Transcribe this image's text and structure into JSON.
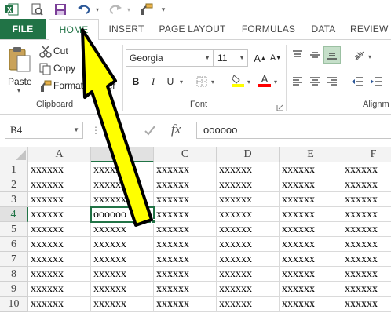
{
  "quick_access": {
    "icons": [
      "excel-logo-icon",
      "print-preview-icon",
      "save-icon",
      "undo-icon",
      "redo-icon",
      "format-painter-icon",
      "customize-icon"
    ]
  },
  "tabs": {
    "file": "FILE",
    "home": "HOME",
    "insert": "INSERT",
    "page_layout": "PAGE LAYOUT",
    "formulas": "FORMULAS",
    "data": "DATA",
    "review": "REVIEW"
  },
  "clipboard": {
    "paste": "Paste",
    "cut": "Cut",
    "copy": "Copy",
    "format_painter": "Format Painter",
    "group_label": "Clipboard"
  },
  "font": {
    "name": "Georgia",
    "size": "11",
    "bold": "B",
    "italic": "I",
    "underline": "U",
    "group_label": "Font",
    "fill_color": "#ffff00",
    "font_color": "#ff0000"
  },
  "alignment": {
    "group_label": "Alignm"
  },
  "formula_bar": {
    "name_box": "B4",
    "fx": "fx",
    "value": "oooooo"
  },
  "sheet": {
    "columns": [
      "A",
      "B",
      "C",
      "D",
      "E",
      "F"
    ],
    "rows": [
      {
        "num": "1",
        "cells": [
          "xxxxxx",
          "xxxxxx",
          "xxxxxx",
          "xxxxxx",
          "xxxxxx",
          "xxxxxx"
        ]
      },
      {
        "num": "2",
        "cells": [
          "xxxxxx",
          "xxxxxx",
          "xxxxxx",
          "xxxxxx",
          "xxxxxx",
          "xxxxxx"
        ]
      },
      {
        "num": "3",
        "cells": [
          "xxxxxx",
          "xxxxxx",
          "xxxxxx",
          "xxxxxx",
          "xxxxxx",
          "xxxxxx"
        ]
      },
      {
        "num": "4",
        "cells": [
          "xxxxxx",
          "oooooo",
          "xxxxxx",
          "xxxxxx",
          "xxxxxx",
          "xxxxxx"
        ]
      },
      {
        "num": "5",
        "cells": [
          "xxxxxx",
          "xxxxxx",
          "xxxxxx",
          "xxxxxx",
          "xxxxxx",
          "xxxxxx"
        ]
      },
      {
        "num": "6",
        "cells": [
          "xxxxxx",
          "xxxxxx",
          "xxxxxx",
          "xxxxxx",
          "xxxxxx",
          "xxxxxx"
        ]
      },
      {
        "num": "7",
        "cells": [
          "xxxxxx",
          "xxxxxx",
          "xxxxxx",
          "xxxxxx",
          "xxxxxx",
          "xxxxxx"
        ]
      },
      {
        "num": "8",
        "cells": [
          "xxxxxx",
          "xxxxxx",
          "xxxxxx",
          "xxxxxx",
          "xxxxxx",
          "xxxxxx"
        ]
      },
      {
        "num": "9",
        "cells": [
          "xxxxxx",
          "xxxxxx",
          "xxxxxx",
          "xxxxxx",
          "xxxxxx",
          "xxxxxx"
        ]
      },
      {
        "num": "10",
        "cells": [
          "xxxxxx",
          "xxxxxx",
          "xxxxxx",
          "xxxxxx",
          "xxxxxx",
          "xxxxxx"
        ]
      }
    ]
  },
  "colors": {
    "accent": "#217346",
    "annotation_arrow": "#ffff00"
  }
}
